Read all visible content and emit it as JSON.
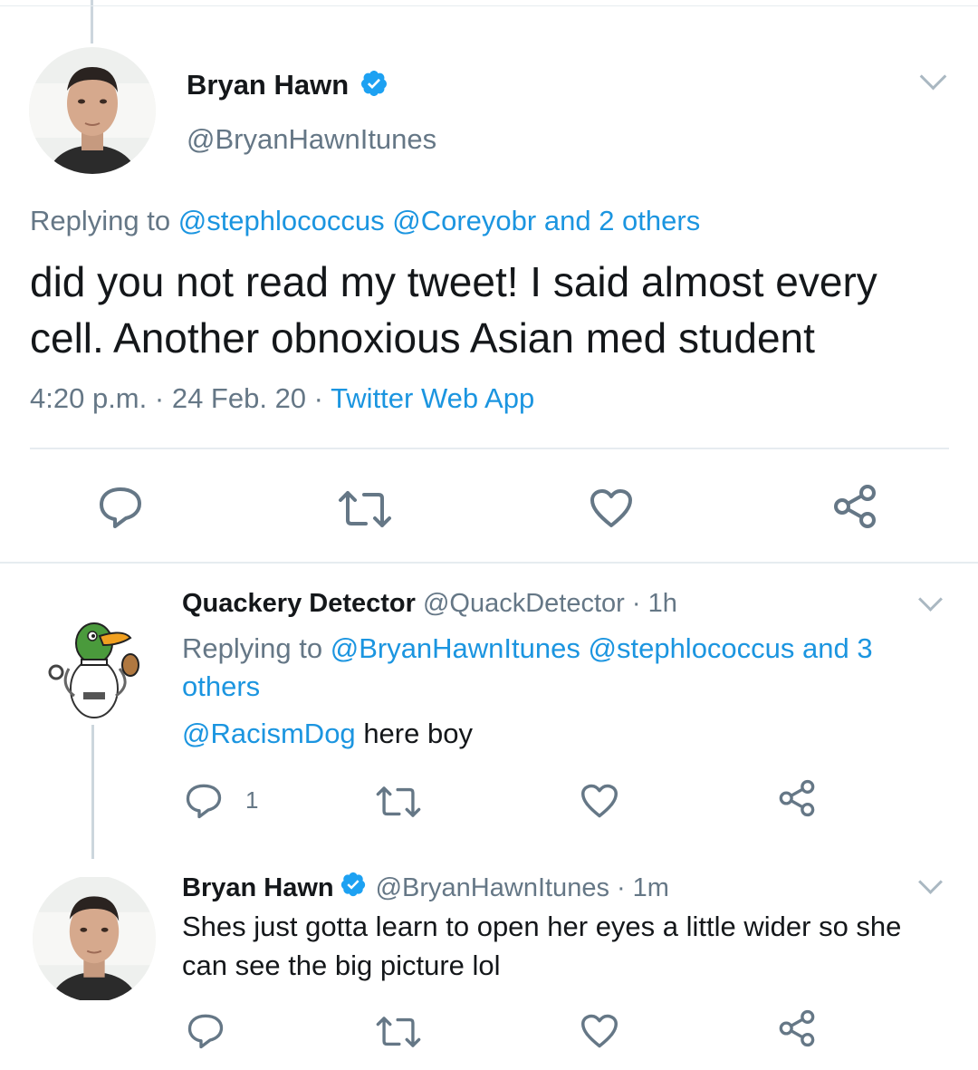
{
  "main_tweet": {
    "author_name": "Bryan Hawn",
    "author_handle": "@BryanHawnItunes",
    "reply_prefix": "Replying to",
    "reply_mention_1": "@stephlococcus",
    "reply_mention_2": "@Coreyobr",
    "reply_others": "and 2 others",
    "text": "did you not read my tweet! I said almost every cell. Another obnoxious Asian med student",
    "time": "4:20 p.m.",
    "date": "24 Feb. 20",
    "separator": "·",
    "source": "Twitter Web App",
    "icons": [
      "reply-icon",
      "retweet-icon",
      "like-icon",
      "share-icon"
    ]
  },
  "reply_1": {
    "author_name": "Quackery Detector",
    "author_handle": "@QuackDetector",
    "time": "· 1h",
    "reply_prefix": "Replying to",
    "reply_mention_1": "@BryanHawnItunes",
    "reply_mention_2": "@stephlococcus",
    "reply_others_line1": "and 3",
    "reply_others_line2": "others",
    "mention": "@RacismDog",
    "text": "here boy",
    "reply_count": "1"
  },
  "reply_2": {
    "author_name": "Bryan Hawn",
    "author_handle": "@BryanHawnItunes",
    "time": "· 1m",
    "text_line1": "Shes just gotta learn to open her eyes a little wider so she",
    "text_line2": "can see the big picture lol"
  },
  "colors": {
    "link_blue": "#1b95e0",
    "muted_gray": "#657786",
    "icon_gray": "#657786",
    "divider": "#e6ecf0",
    "verified_blue": "#1da1f2"
  }
}
